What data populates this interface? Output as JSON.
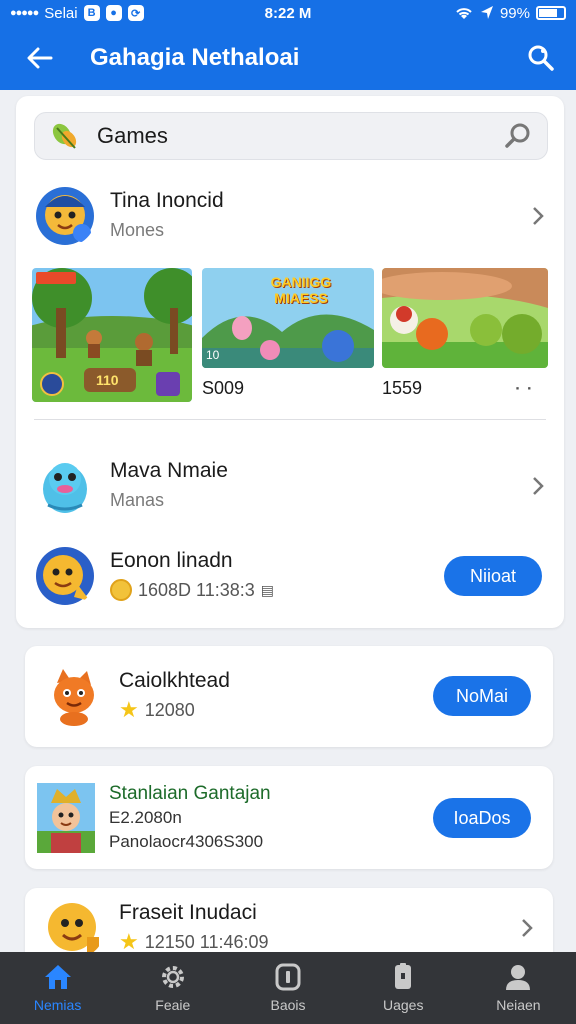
{
  "status_bar": {
    "carrier": "Selai",
    "time": "8:22 M",
    "battery": "99%"
  },
  "app_bar": {
    "title": "Gahagia Nethaloai"
  },
  "search": {
    "value": "Games"
  },
  "feed": {
    "row1": {
      "title": "Tina Inoncid",
      "subtitle": "Mones"
    },
    "thumbnails": [
      {
        "badge": "110",
        "label": ""
      },
      {
        "banner": "GANIIGG MIAESS",
        "badge": "10",
        "label": "S009"
      },
      {
        "label": "1559"
      }
    ],
    "row2": {
      "title": "Mava Nmaie",
      "subtitle": "Manas"
    },
    "row3": {
      "title": "Eonon linadn",
      "meta": "1608D 11:38:3",
      "button": "Niioat"
    }
  },
  "cards": [
    {
      "title": "Caiolkhtead",
      "meta": "12080",
      "button": "NoMai"
    },
    {
      "title": "Stanlaian Gantajan",
      "line2": "E2.2080n",
      "line3": "Panolaocr4306S300",
      "button": "IoaDos"
    },
    {
      "title": "Fraseit Inudaci",
      "meta": "12150 11:46:09"
    }
  ],
  "bottom_nav": [
    {
      "label": "Nemias",
      "icon": "home-icon",
      "active": true
    },
    {
      "label": "Feaie",
      "icon": "gear-icon",
      "active": false
    },
    {
      "label": "Baois",
      "icon": "slot-icon",
      "active": false
    },
    {
      "label": "Uages",
      "icon": "lock-icon",
      "active": false
    },
    {
      "label": "Neiaen",
      "icon": "person-icon",
      "active": false
    }
  ],
  "colors": {
    "primary": "#1670e6",
    "pill": "#1a73e8",
    "nav_bg": "#333539",
    "nav_active": "#2a86ff"
  }
}
